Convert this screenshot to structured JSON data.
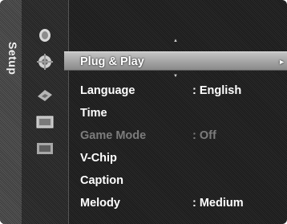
{
  "sidebar": {
    "title": "Setup"
  },
  "icons": [
    {
      "name": "picture-icon"
    },
    {
      "name": "sound-icon"
    },
    {
      "name": "channel-icon"
    },
    {
      "name": "input-icon"
    },
    {
      "name": "support-icon"
    }
  ],
  "menu": {
    "items": [
      {
        "label": "Plug & Play",
        "value": "",
        "selected": true,
        "disabled": false
      },
      {
        "label": "Language",
        "value": ": English",
        "selected": false,
        "disabled": false
      },
      {
        "label": "Time",
        "value": "",
        "selected": false,
        "disabled": false
      },
      {
        "label": "Game Mode",
        "value": ": Off",
        "selected": false,
        "disabled": true
      },
      {
        "label": "V-Chip",
        "value": "",
        "selected": false,
        "disabled": false
      },
      {
        "label": "Caption",
        "value": "",
        "selected": false,
        "disabled": false
      },
      {
        "label": "Melody",
        "value": ": Medium",
        "selected": false,
        "disabled": false
      }
    ]
  },
  "colors": {
    "text": "#ffffff",
    "disabled_text": "#7c7c7c",
    "highlight": "#a9a9a9"
  }
}
